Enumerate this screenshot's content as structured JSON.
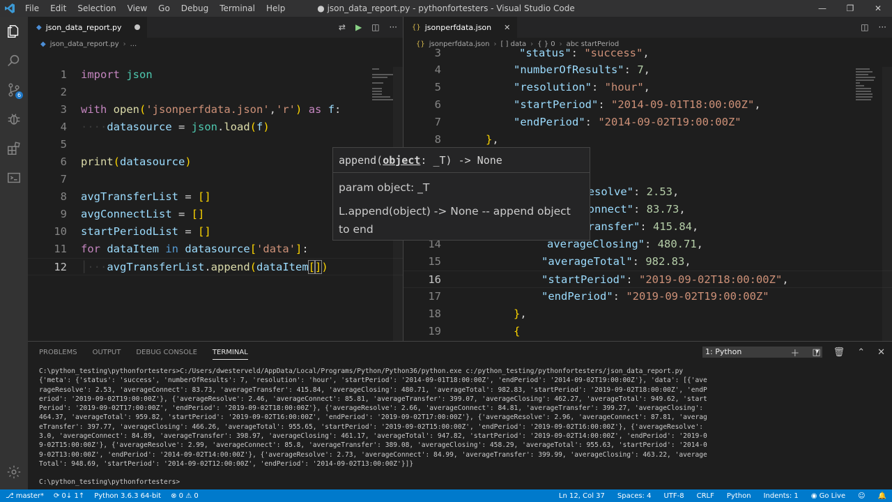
{
  "window": {
    "title": "● json_data_report.py - pythonfortesters - Visual Studio Code",
    "menu": [
      "File",
      "Edit",
      "Selection",
      "View",
      "Go",
      "Debug",
      "Terminal",
      "Help"
    ],
    "controls": {
      "minimize": "—",
      "restore": "❐",
      "close": "✕"
    }
  },
  "left_editor": {
    "tab_label": "json_data_report.py",
    "breadcrumb": [
      "json_data_report.py",
      "..."
    ],
    "current_line": "12"
  },
  "right_editor": {
    "tab_label": "jsonperfdata.json",
    "breadcrumb": [
      "jsonperfdata.json",
      "[ ] data",
      "{ } 0",
      "abc startPeriod"
    ]
  },
  "hover": {
    "signature_prefix": "append(",
    "signature_param": "object",
    "signature_suffix": ": _T) -> None",
    "param_doc": "param object: _T",
    "doc": "L.append(object) -> None -- append object to end"
  },
  "panel": {
    "tabs": [
      "PROBLEMS",
      "OUTPUT",
      "DEBUG CONSOLE",
      "TERMINAL"
    ],
    "active_tab": "TERMINAL",
    "terminal_select": "1: Python",
    "terminal_lines": [
      "C:\\python_testing\\pythonfortesters>C:/Users/dwesterveld/AppData/Local/Programs/Python/Python36/python.exe c:/python_testing/pythonfortesters/json_data_report.py",
      "{'meta': {'status': 'success', 'numberOfResults': 7, 'resolution': 'hour', 'startPeriod': '2014-09-01T18:00:00Z', 'endPeriod': '2014-09-02T19:00:00Z'}, 'data': [{'ave",
      "rageResolve': 2.53, 'averageConnect': 83.73, 'averageTransfer': 415.84, 'averageClosing': 480.71, 'averageTotal': 982.83, 'startPeriod': '2019-09-02T18:00:00Z', 'endP",
      "eriod': '2019-09-02T19:00:00Z'}, {'averageResolve': 2.46, 'averageConnect': 85.81, 'averageTransfer': 399.07, 'averageClosing': 462.27, 'averageTotal': 949.62, 'start",
      "Period': '2019-09-02T17:00:00Z', 'endPeriod': '2019-09-02T18:00:00Z'}, {'averageResolve': 2.66, 'averageConnect': 84.81, 'averageTransfer': 399.27, 'averageClosing':",
      "464.37, 'averageTotal': 959.82, 'startPeriod': '2019-09-02T16:00:00Z', 'endPeriod': '2019-09-02T17:00:00Z'}, {'averageResolve': 2.96, 'averageConnect': 87.81, 'averag",
      "eTransfer': 397.77, 'averageClosing': 466.26, 'averageTotal': 955.65, 'startPeriod': '2019-09-02T15:00:00Z', 'endPeriod': '2019-09-02T16:00:00Z'}, {'averageResolve':",
      "3.0, 'averageConnect': 84.89, 'averageTransfer': 398.97, 'averageClosing': 461.17, 'averageTotal': 947.82, 'startPeriod': '2019-09-02T14:00:00Z', 'endPeriod': '2019-0",
      "9-02T15:00:00Z'}, {'averageResolve': 2.99, 'averageConnect': 85.8, 'averageTransfer': 389.08, 'averageClosing': 458.29, 'averageTotal': 955.63, 'startPeriod': '2014-0",
      "9-02T13:00:00Z', 'endPeriod': '2014-09-02T14:00:00Z'}, {'averageResolve': 2.73, 'averageConnect': 84.99, 'averageTransfer': 399.99, 'averageClosing': 463.22, 'average",
      "Total': 948.69, 'startPeriod': '2014-09-02T12:00:00Z', 'endPeriod': '2014-09-02T13:00:00Z'}]}",
      "",
      "C:\\python_testing\\pythonfortesters>"
    ]
  },
  "statusbar": {
    "branch": "master*",
    "sync": "0↓ 1↑",
    "interpreter": "Python 3.6.3 64-bit",
    "errors": "0",
    "warnings": "0",
    "position": "Ln 12, Col 37",
    "spaces": "Spaces: 4",
    "encoding": "UTF-8",
    "eol": "CRLF",
    "language": "Python",
    "indents": "Indents: 1",
    "golive": "Go Live"
  },
  "colors": {
    "accent": "#007acc",
    "editor_bg": "#1e1e1e",
    "keyword": "#c586c0",
    "string": "#ce9178",
    "function": "#dcdcaa",
    "variable": "#9cdcfe",
    "number": "#b5cea8"
  }
}
